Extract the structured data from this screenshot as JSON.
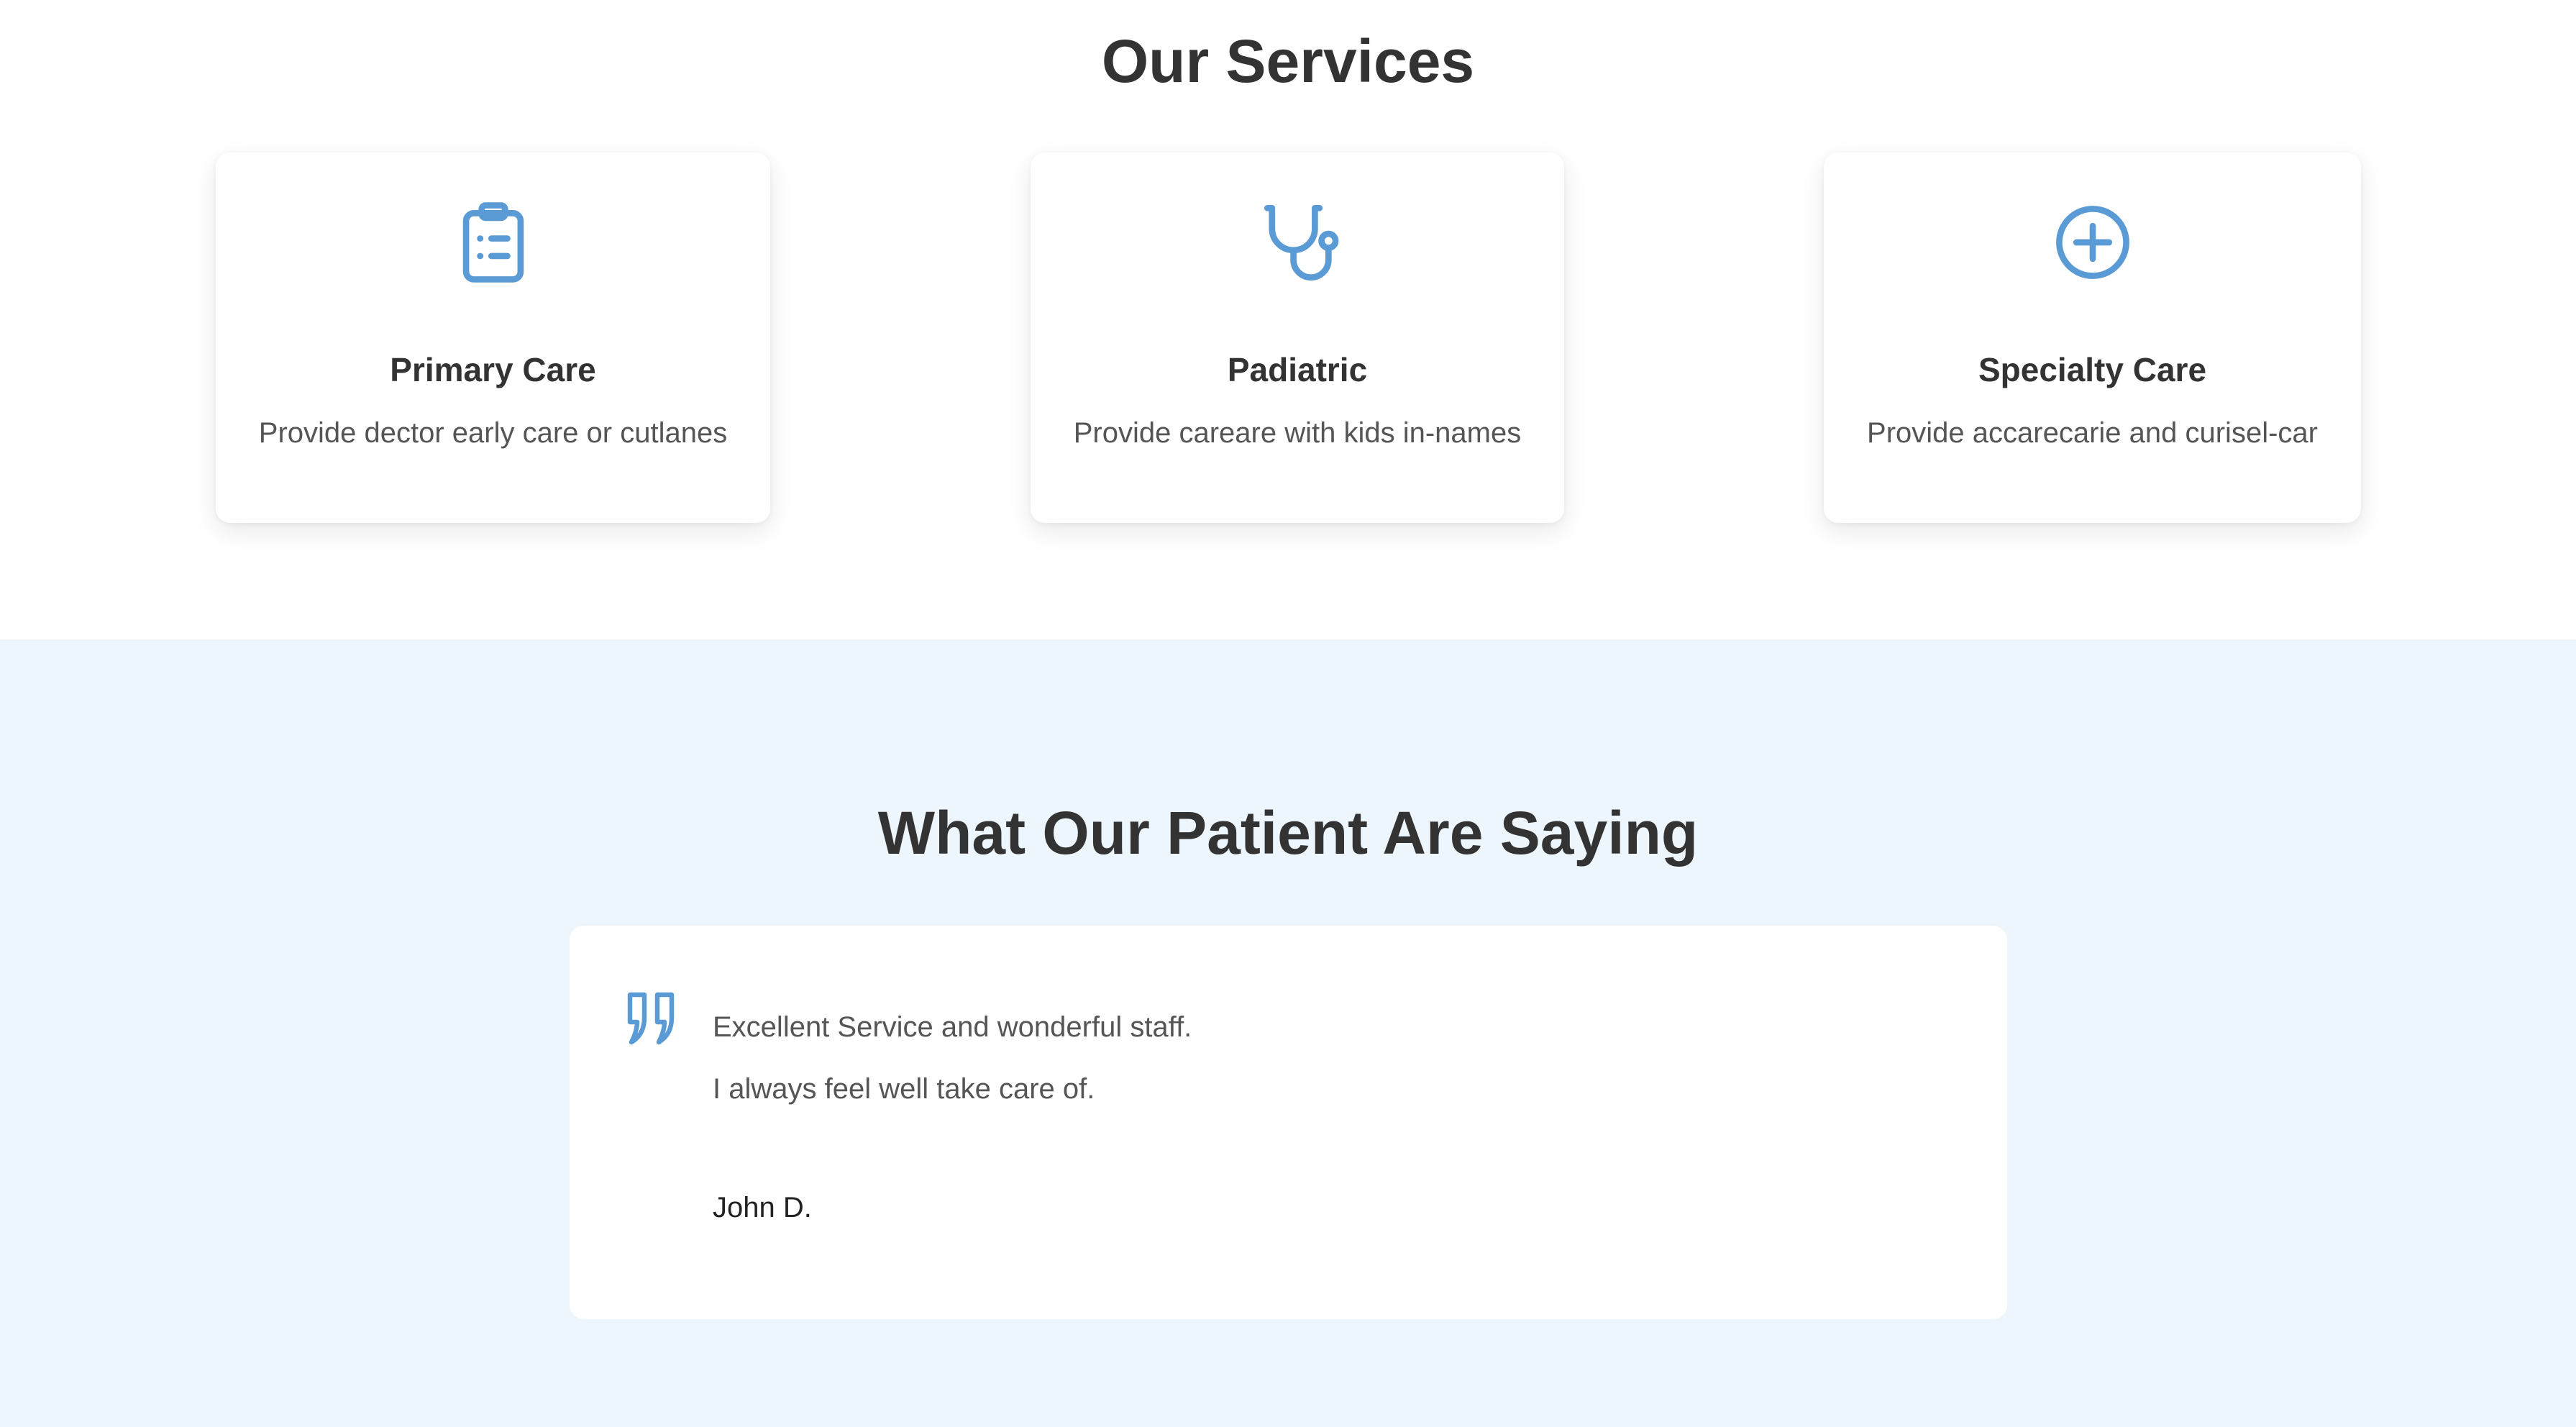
{
  "services": {
    "title": "Our Services",
    "cards": [
      {
        "icon": "clipboard-list-icon",
        "title": "Primary Care",
        "description": "Provide dector early care or cutlanes"
      },
      {
        "icon": "stethoscope-icon",
        "title": "Padiatric",
        "description": "Provide careare with kids in-names"
      },
      {
        "icon": "plus-circle-icon",
        "title": "Specialty Care",
        "description": "Provide accarecarie and curisel-car"
      }
    ]
  },
  "testimonials": {
    "title": "What Our Patient Are Saying",
    "quote_icon": "quote-icon",
    "quote_lines": [
      "Excellent Service and wonderful staff.",
      "I always feel well take care of."
    ],
    "author": "John D."
  },
  "colors": {
    "accent": "#5b9bd5",
    "heading": "#333333",
    "body_text": "#555555",
    "testimonials_bg": "#eef6fd",
    "card_bg": "#ffffff"
  }
}
